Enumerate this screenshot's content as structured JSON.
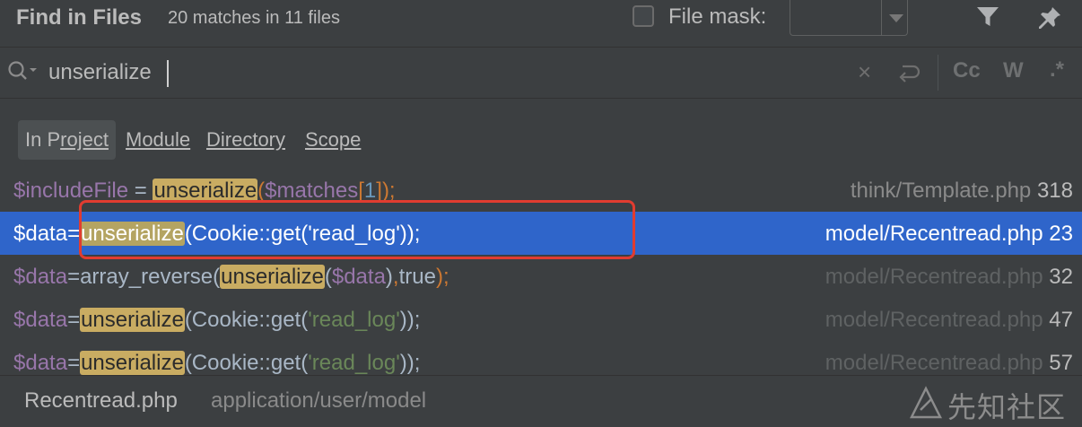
{
  "header": {
    "title": "Find in Files",
    "match_count": "20 matches in 11 files",
    "file_mask_label": "File mask:",
    "file_mask_checked": false
  },
  "search": {
    "query": "unserialize"
  },
  "scopes": [
    {
      "label": "In Project",
      "active": true
    },
    {
      "label": "Module",
      "active": false
    },
    {
      "label": "Directory",
      "active": false
    },
    {
      "label": "Scope",
      "active": false
    }
  ],
  "results": [
    {
      "var": "$includeFile",
      "mid": " = ",
      "match": "unserialize",
      "rest": "(",
      "arg": "$matches",
      "idx_open": "[",
      "idx": "1",
      "idx_close": "]",
      "end": ");",
      "path": "think/Template.php",
      "line": "318"
    },
    {
      "var": "$data",
      "mid": "=",
      "match": "unserialize",
      "rest": "(Cookie::get(",
      "str": "'read_log'",
      "end": "));",
      "path": "model/Recentread.php",
      "line": "23",
      "selected": true
    },
    {
      "var": "$data",
      "mid": "=array_reverse(",
      "match": "unserialize",
      "rest": "(",
      "arg": "$data",
      "rest2": ")",
      "comma": ",",
      "kw": "true",
      "end": ");",
      "path": "model/Recentread.php",
      "line": "32"
    },
    {
      "var": "$data",
      "mid": "=",
      "match": "unserialize",
      "rest": "(Cookie::get(",
      "str": "'read_log'",
      "end": "));",
      "path": "model/Recentread.php",
      "line": "47"
    },
    {
      "var": "$data",
      "mid": "=",
      "match": "unserialize",
      "rest": "(Cookie::get(",
      "str": "'read_log'",
      "end": "));",
      "path": "model/Recentread.php",
      "line": "57"
    }
  ],
  "footer": {
    "file": "Recentread.php",
    "path": "application/user/model"
  },
  "watermark": {
    "text": "先知社区"
  },
  "colors": {
    "background": "#3c3f41",
    "selection": "#2f65ca",
    "match_highlight": "#c9ac62",
    "annotation_box": "#e13c30"
  }
}
